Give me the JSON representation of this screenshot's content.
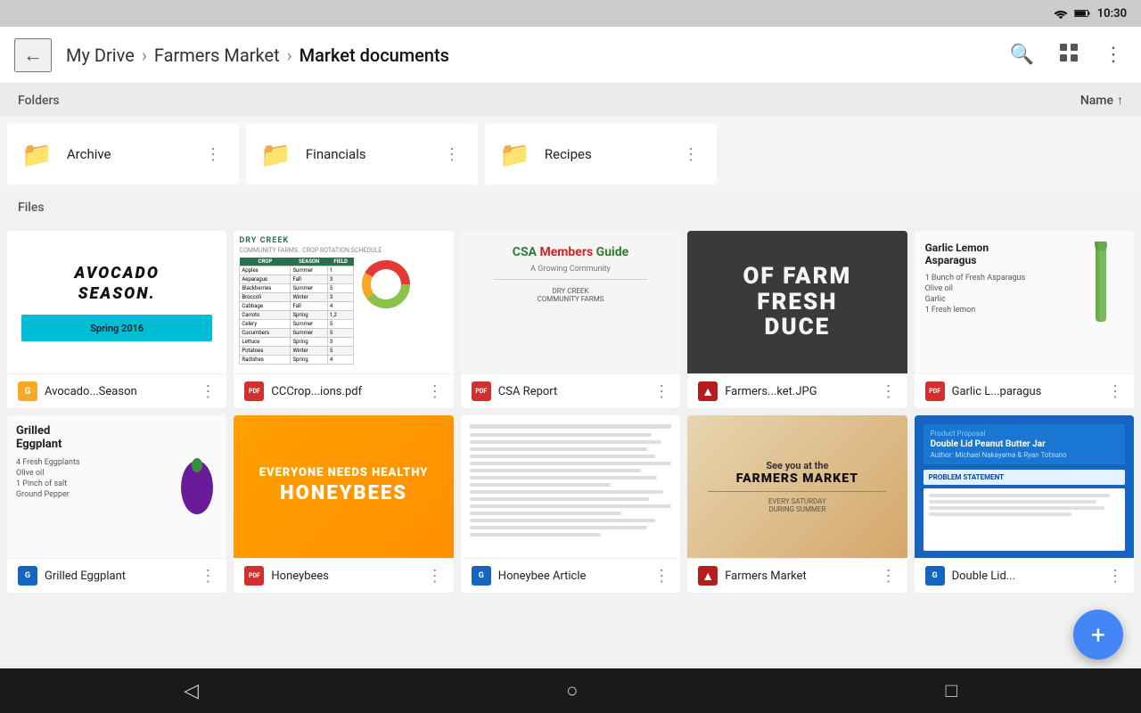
{
  "statusBar": {
    "time": "10:30"
  },
  "toolbar": {
    "backLabel": "←",
    "breadcrumb": [
      {
        "label": "My Drive",
        "isCurrent": false
      },
      {
        "label": "Farmers Market",
        "isCurrent": false
      },
      {
        "label": "Market documents",
        "isCurrent": true
      }
    ],
    "sortLabel": "Name",
    "sortDir": "↑"
  },
  "sections": {
    "foldersLabel": "Folders",
    "filesLabel": "Files"
  },
  "folders": [
    {
      "name": "Archive",
      "colorClass": "gray"
    },
    {
      "name": "Financials",
      "colorClass": "orange"
    },
    {
      "name": "Recipes",
      "colorClass": "purple"
    }
  ],
  "files": [
    {
      "name": "Avocado...Season",
      "typeIcon": "▪",
      "typeClass": "yellow",
      "typeLabel": "G"
    },
    {
      "name": "CCCrop...ions.pdf",
      "typeIcon": "PDF",
      "typeClass": "red",
      "typeLabel": "PDF"
    },
    {
      "name": "CSA Report",
      "typeIcon": "PDF",
      "typeClass": "red",
      "typeLabel": "PDF"
    },
    {
      "name": "Farmers...ket.JPG",
      "typeIcon": "▲",
      "typeClass": "red",
      "typeLabel": "IMG"
    },
    {
      "name": "Garlic L...paragus",
      "typeIcon": "PDF",
      "typeClass": "red",
      "typeLabel": "PDF"
    },
    {
      "name": "Grilled Eggplant",
      "typeIcon": "G",
      "typeClass": "blue",
      "typeLabel": "G"
    },
    {
      "name": "Honeybees",
      "typeIcon": "PDF",
      "typeClass": "red",
      "typeLabel": "PDF"
    },
    {
      "name": "Honeybee Article",
      "typeIcon": "G",
      "typeClass": "blue",
      "typeLabel": "G"
    },
    {
      "name": "Farmers Market",
      "typeIcon": "▲",
      "typeClass": "red",
      "typeLabel": "IMG"
    },
    {
      "name": "Double Lid...",
      "typeIcon": "G",
      "typeClass": "blue",
      "typeLabel": "G"
    }
  ],
  "fab": {
    "label": "+"
  },
  "bottomNav": {
    "back": "◁",
    "home": "○",
    "recent": "□"
  }
}
